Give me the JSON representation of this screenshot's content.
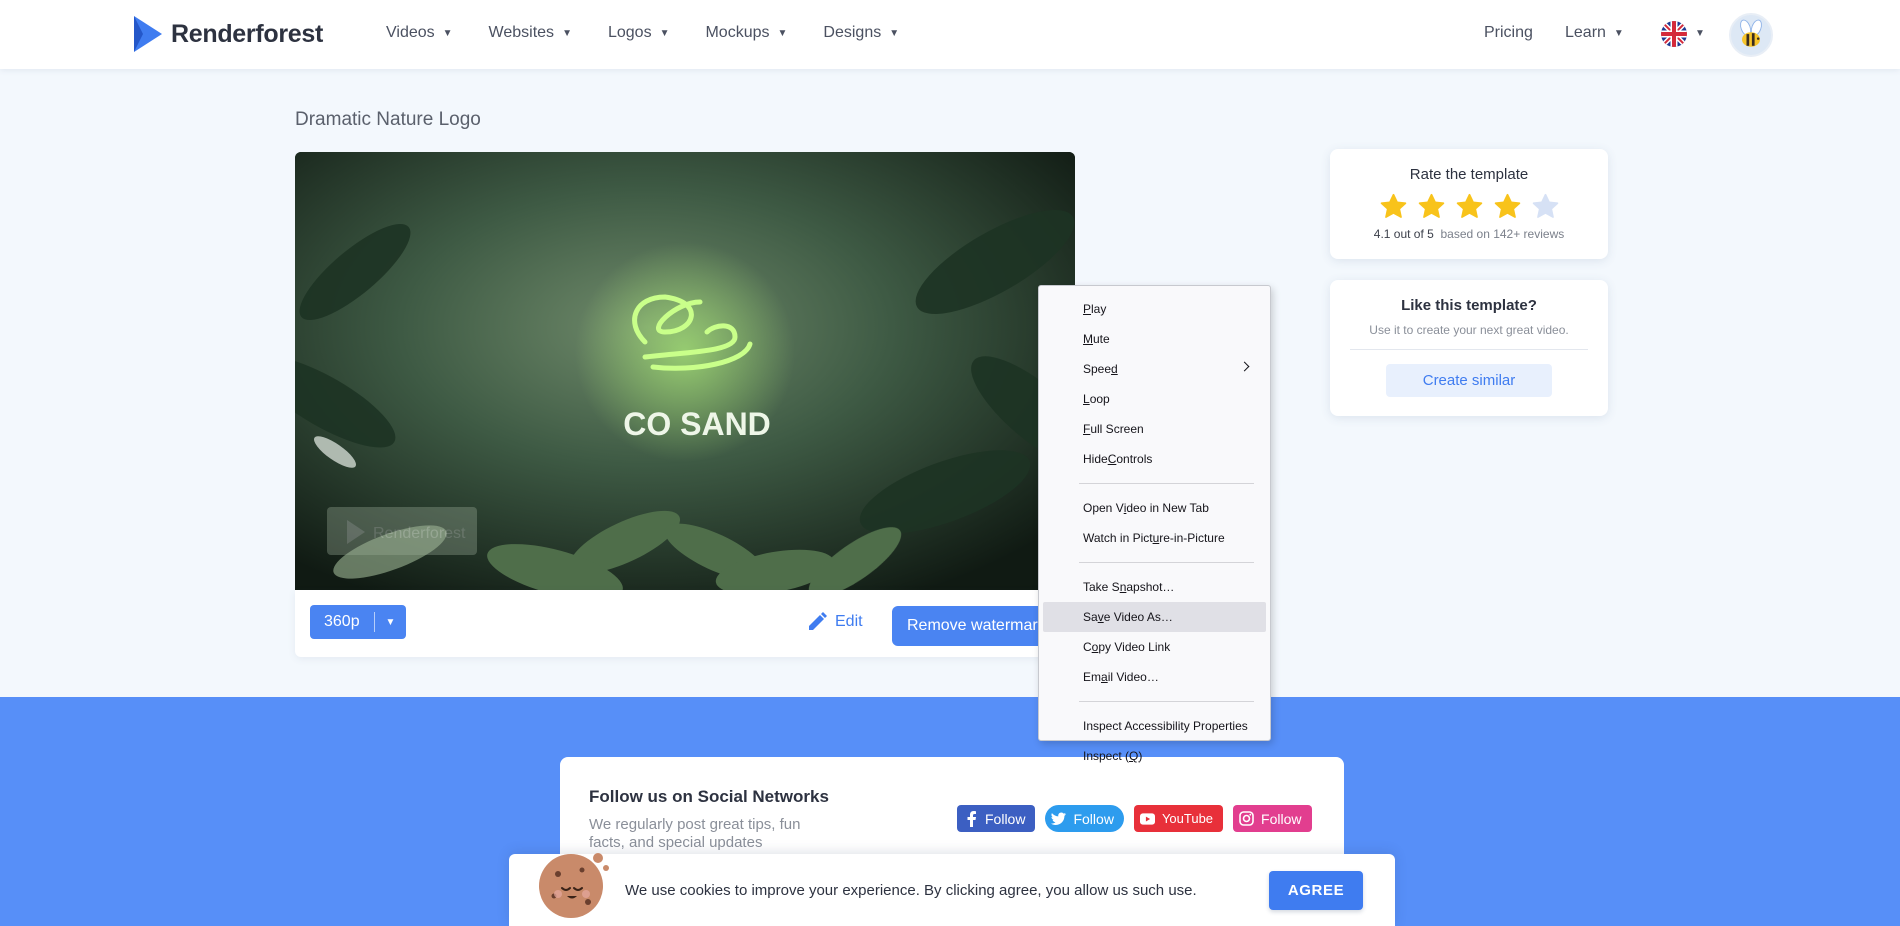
{
  "brand": {
    "name": "Renderforest"
  },
  "nav": {
    "items": [
      {
        "label": "Videos"
      },
      {
        "label": "Websites"
      },
      {
        "label": "Logos"
      },
      {
        "label": "Mockups"
      },
      {
        "label": "Designs"
      }
    ],
    "pricing": "Pricing",
    "learn": "Learn"
  },
  "page": {
    "title": "Dramatic Nature Logo"
  },
  "video": {
    "logo_text": "CO SAND",
    "watermark": "Renderforest",
    "quality": "360p",
    "edit_label": "Edit",
    "remove_watermark_label": "Remove watermark"
  },
  "rating": {
    "title": "Rate the template",
    "score_text": "4.1 out of 5",
    "reviews_text": "based on 142+ reviews",
    "stars_filled": 4,
    "stars_total": 5,
    "star_color": "#f8c31b",
    "star_empty_color": "#d6e1f5"
  },
  "like": {
    "title": "Like this template?",
    "subtitle": "Use it to create your next great video.",
    "button": "Create similar"
  },
  "social": {
    "title": "Follow us on Social Networks",
    "subtitle": "We regularly post great tips, fun facts, and special updates",
    "buttons": [
      {
        "network": "facebook",
        "label": "Follow",
        "icon": "facebook-icon"
      },
      {
        "network": "twitter",
        "label": "Follow",
        "icon": "twitter-icon"
      },
      {
        "network": "youtube",
        "label": "YouTube",
        "icon": "youtube-icon"
      },
      {
        "network": "instagram",
        "label": "Follow",
        "icon": "instagram-icon"
      }
    ]
  },
  "cookie": {
    "text": "We use cookies to improve your experience. By clicking agree, you allow us such use.",
    "button": "AGREE"
  },
  "context_menu": {
    "items": [
      {
        "pre": "",
        "u": "P",
        "post": "lay"
      },
      {
        "pre": "",
        "u": "M",
        "post": "ute"
      },
      {
        "pre": "Spee",
        "u": "d",
        "post": "",
        "submenu": true
      },
      {
        "pre": "",
        "u": "L",
        "post": "oop"
      },
      {
        "pre": "",
        "u": "F",
        "post": "ull Screen"
      },
      {
        "pre": "Hide ",
        "u": "C",
        "post": "ontrols"
      },
      {
        "separator": true
      },
      {
        "pre": "Open V",
        "u": "i",
        "post": "deo in New Tab"
      },
      {
        "pre": "Watch in Pict",
        "u": "u",
        "post": "re-in-Picture"
      },
      {
        "separator": true
      },
      {
        "pre": "Take S",
        "u": "n",
        "post": "apshot…"
      },
      {
        "pre": "Sa",
        "u": "v",
        "post": "e Video As…",
        "hover": true
      },
      {
        "pre": "C",
        "u": "o",
        "post": "py Video Link"
      },
      {
        "pre": "Em",
        "u": "a",
        "post": "il Video…"
      },
      {
        "separator": true
      },
      {
        "pre": "Inspect Accessibility Properties",
        "u": "",
        "post": ""
      },
      {
        "pre": "Inspect (",
        "u": "Q",
        "post": ")"
      }
    ]
  }
}
